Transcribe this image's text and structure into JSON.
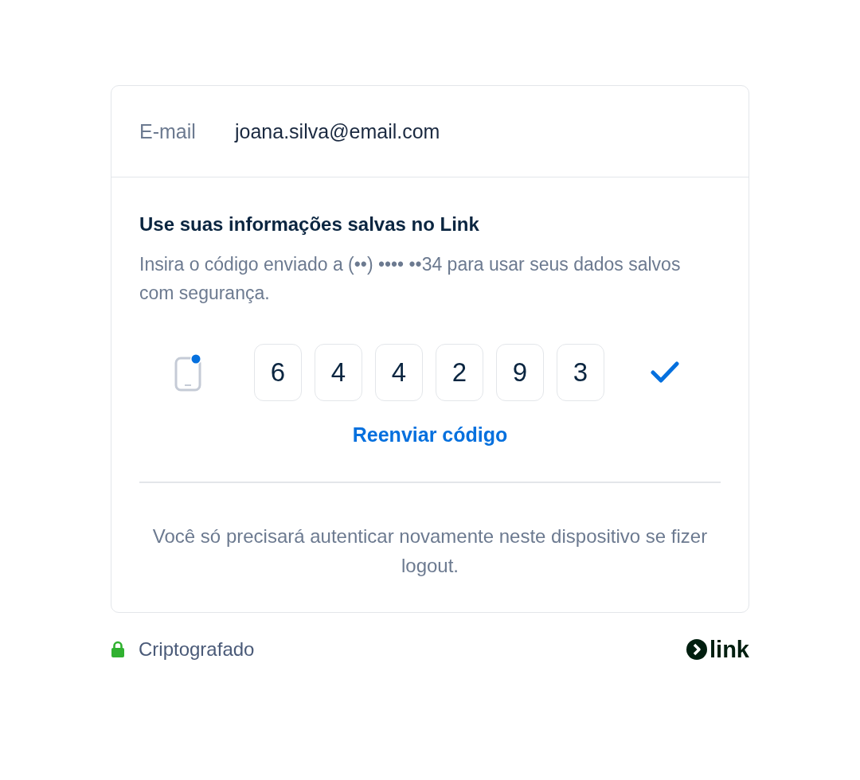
{
  "email": {
    "label": "E-mail",
    "value": "joana.silva@email.com"
  },
  "verification": {
    "title": "Use suas informações salvas no Link",
    "description": "Insira o código enviado a (••) •••• ••34 para usar seus dados salvos com segurança.",
    "code_sent": true,
    "digits": [
      "6",
      "4",
      "4",
      "2",
      "9",
      "3"
    ],
    "verified": true,
    "resend_link": "Reenviar código",
    "note": "Você só precisará autenticar novamente neste dispositivo se fizer logout."
  },
  "footer": {
    "security_label": "Criptografado",
    "brand": "link"
  }
}
